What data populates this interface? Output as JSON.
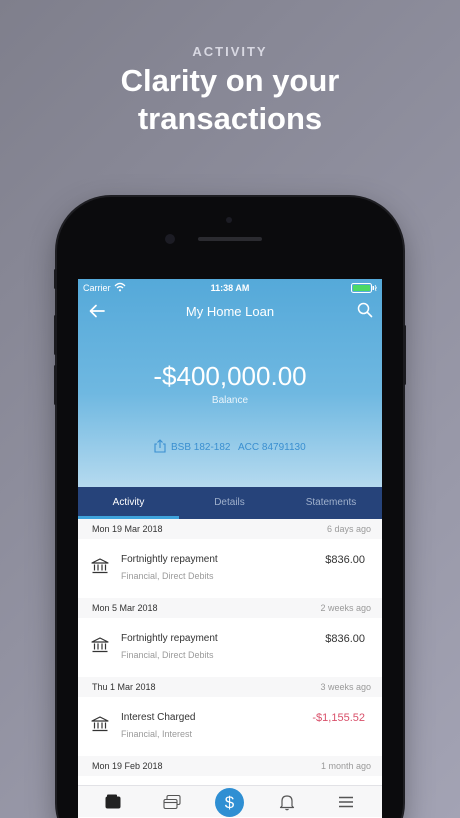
{
  "promo": {
    "kicker": "ACTIVITY",
    "title_line1": "Clarity on your",
    "title_line2": "transactions"
  },
  "status_bar": {
    "carrier": "Carrier",
    "time": "11:38 AM"
  },
  "nav": {
    "title": "My Home Loan"
  },
  "account": {
    "balance": "-$400,000.00",
    "balance_label": "Balance",
    "bsb": "BSB 182-182",
    "acc": "ACC 84791130"
  },
  "tabs": [
    {
      "label": "Activity",
      "active": true
    },
    {
      "label": "Details",
      "active": false
    },
    {
      "label": "Statements",
      "active": false
    }
  ],
  "activity": [
    {
      "date": "Mon 19 Mar 2018",
      "ago": "6 days ago",
      "name": "Fortnightly repayment",
      "category": "Financial, Direct Debits",
      "amount": "$836.00"
    },
    {
      "date": "Mon 5 Mar 2018",
      "ago": "2 weeks ago",
      "name": "Fortnightly repayment",
      "category": "Financial, Direct Debits",
      "amount": "$836.00"
    },
    {
      "date": "Thu 1 Mar 2018",
      "ago": "3 weeks ago",
      "name": "Interest Charged",
      "category": "Financial, Interest",
      "amount": "-$1,155.52"
    },
    {
      "date": "Mon 19 Feb 2018",
      "ago": "1 month ago"
    }
  ],
  "bottom_nav": {
    "pay_symbol": "$",
    "icons": [
      "wallet-icon",
      "cards-icon",
      "dollar-icon",
      "bell-icon",
      "menu-icon"
    ]
  },
  "colors": {
    "hero_top": "#55a9d9",
    "tabbar": "#26437a",
    "accent": "#2f8fd3",
    "negative": "#d9506a"
  }
}
